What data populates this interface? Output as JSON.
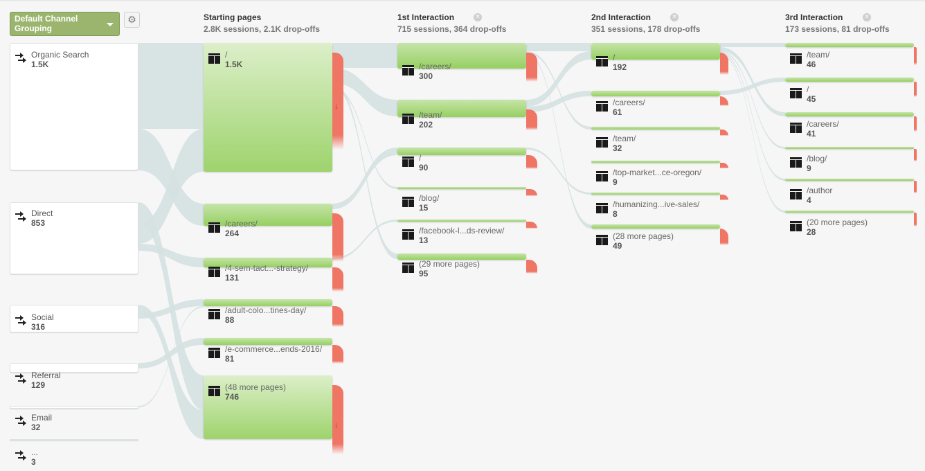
{
  "controls": {
    "dimension_label": "Default Channel Grouping",
    "settings_icon": "gear-icon",
    "dimension_icon": "caret-down-icon"
  },
  "columns": [
    {
      "title": "Starting pages",
      "summary": "2.8K sessions, 2.1K drop-offs",
      "closable": false
    },
    {
      "title": "1st Interaction",
      "summary": "715 sessions, 364 drop-offs",
      "closable": true
    },
    {
      "title": "2nd Interaction",
      "summary": "351 sessions, 178 drop-offs",
      "closable": true
    },
    {
      "title": "3rd Interaction",
      "summary": "173 sessions, 81 drop-offs",
      "closable": true
    }
  ],
  "sources": [
    {
      "name": "Organic Search",
      "value": "1.5K"
    },
    {
      "name": "Direct",
      "value": "853"
    },
    {
      "name": "Social",
      "value": "316"
    },
    {
      "name": "Referral",
      "value": "129"
    },
    {
      "name": "Email",
      "value": "32"
    },
    {
      "name": "...",
      "value": "3"
    }
  ],
  "starting_pages": [
    {
      "name": "/",
      "value": "1.5K"
    },
    {
      "name": "/careers/",
      "value": "264"
    },
    {
      "name": "/4-sem-tact...-strategy/",
      "value": "131"
    },
    {
      "name": "/adult-colo...tines-day/",
      "value": "88"
    },
    {
      "name": "/e-commerce...ends-2016/",
      "value": "81"
    },
    {
      "name": "(48 more pages)",
      "value": "746"
    }
  ],
  "interaction_1": [
    {
      "name": "/careers/",
      "value": "300"
    },
    {
      "name": "/team/",
      "value": "202"
    },
    {
      "name": "/",
      "value": "90"
    },
    {
      "name": "/blog/",
      "value": "15"
    },
    {
      "name": "/facebook-l...ds-review/",
      "value": "13"
    },
    {
      "name": "(29 more pages)",
      "value": "95"
    }
  ],
  "interaction_2": [
    {
      "name": "/",
      "value": "192"
    },
    {
      "name": "/careers/",
      "value": "61"
    },
    {
      "name": "/team/",
      "value": "32"
    },
    {
      "name": "/top-market...ce-oregon/",
      "value": "9"
    },
    {
      "name": "/humanizing...ive-sales/",
      "value": "8"
    },
    {
      "name": "(28 more pages)",
      "value": "49"
    }
  ],
  "interaction_3": [
    {
      "name": "/team/",
      "value": "46"
    },
    {
      "name": "/",
      "value": "45"
    },
    {
      "name": "/careers/",
      "value": "41"
    },
    {
      "name": "/blog/",
      "value": "9"
    },
    {
      "name": "/author",
      "value": "4"
    },
    {
      "name": "(20 more pages)",
      "value": "28"
    }
  ],
  "colors": {
    "node_green": "#9ed36d",
    "drop_off_red": "#ef7564",
    "flow": "#d6e1e2",
    "dimension_button": "#9bb56f"
  }
}
